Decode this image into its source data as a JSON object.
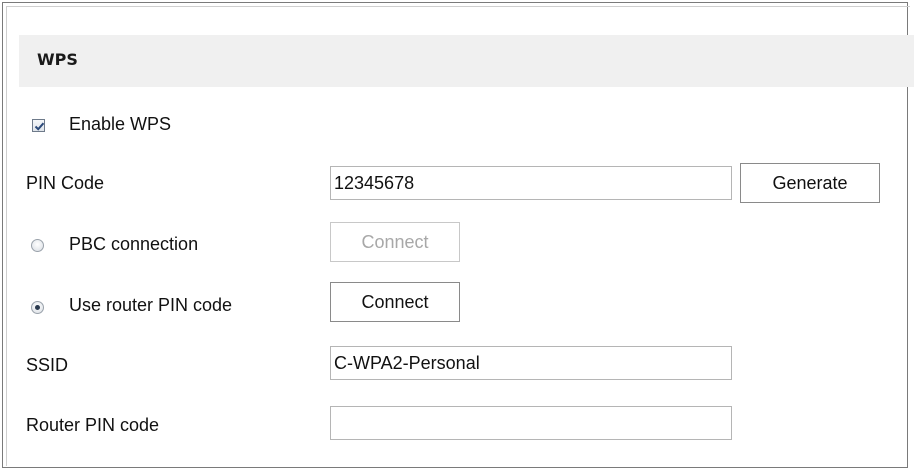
{
  "section": {
    "title": "WPS"
  },
  "enable_wps": {
    "label": "Enable WPS",
    "checked": true
  },
  "pin_code": {
    "label": "PIN Code",
    "value": "12345678",
    "generate_label": "Generate"
  },
  "pbc": {
    "label": "PBC connection",
    "selected": false,
    "connect_label": "Connect",
    "connect_enabled": false
  },
  "router_pin_option": {
    "label": "Use router PIN code",
    "selected": true,
    "connect_label": "Connect",
    "connect_enabled": true
  },
  "ssid": {
    "label": "SSID",
    "value": "C-WPA2-Personal"
  },
  "router_pin_code": {
    "label": "Router PIN code",
    "value": ""
  }
}
